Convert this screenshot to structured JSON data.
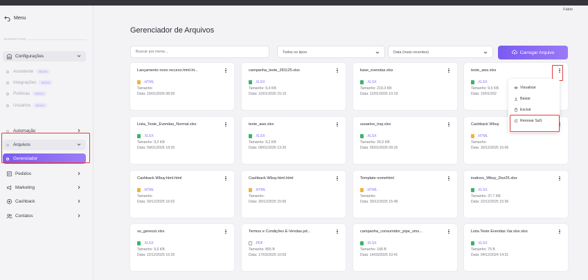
{
  "header": {
    "user_name": "Fábio"
  },
  "sidebar": {
    "menu_label": "Menu",
    "section_label": "MARKETING",
    "items": [
      {
        "label": "Configurações",
        "icon": "building-icon",
        "chevron": "down",
        "kind": "top"
      },
      {
        "label": "Assistente",
        "badge": "Breve",
        "kind": "sub"
      },
      {
        "label": "Integrações",
        "badge": "Breve",
        "kind": "sub"
      },
      {
        "label": "Políticas",
        "badge": "Breve",
        "kind": "sub"
      },
      {
        "label": "Usuários",
        "badge": "Breve",
        "kind": "sub"
      },
      {
        "label": "Automação",
        "chevron": "right",
        "kind": "plain"
      },
      {
        "label": "Arquivos",
        "chevron": "down",
        "kind": "top"
      },
      {
        "label": "Gerenciador",
        "kind": "active"
      },
      {
        "label": "Pedidos",
        "icon": "cart-icon",
        "chevron": "right",
        "kind": "plain"
      },
      {
        "label": "Marketing",
        "icon": "megaphone-icon",
        "chevron": "right",
        "kind": "plain"
      },
      {
        "label": "Cashback",
        "icon": "coin-icon",
        "chevron": "right",
        "kind": "plain"
      },
      {
        "label": "Contatos",
        "icon": "people-icon",
        "chevron": "right",
        "kind": "plain"
      }
    ]
  },
  "main": {
    "title": "Gerenciador de Arquivos",
    "search_placeholder": "Buscar por nome...",
    "type_filter": "Todos os tipos",
    "date_filter": "Data (mais recentes)",
    "upload_label": "Carregar Arquivo"
  },
  "colors": {
    "accent": "#7b5cf0",
    "html": "#f0b43a",
    "xlsx": "#3bb36a",
    "pdf": "#a2a2ad",
    "highlight": "#e03a3a"
  },
  "files": [
    {
      "name": "Lançamento novo recurso.html.ht...",
      "type": ".HTML",
      "size": "Tamanho:",
      "date": "Data: 15/01/2026 08:09"
    },
    {
      "name": "campanha_teste_281125.xlsx",
      "type": ".XLSX",
      "size": "Tamanho: 6,4 KB",
      "date": "Data: 12/01/2026 15:10"
    },
    {
      "name": "base_evendas.xlsx",
      "type": ".XLSX",
      "size": "Tamanho: 219,3 KB",
      "date": "Data: 12/01/2026 10:19"
    },
    {
      "name": "teste_aws.xlsx",
      "type": ".XLSX",
      "size": "Tamanho: 9,5 KB",
      "date": "Data: 10/01/202"
    },
    {
      "name": "Lista_Teste_Evendas_Normal.xlsx",
      "type": ".XLSX",
      "size": "Tamanho: 9,2 KB",
      "date": "Data: 09/01/2026 18:25"
    },
    {
      "name": "teste_aws.xlsx",
      "type": ".XLSX",
      "size": "Tamanho: 9,2 KB",
      "date": "Data: 09/01/2026 13:20"
    },
    {
      "name": "usuarios_tray.xlsx",
      "type": ".XLSX",
      "size": "Tamanho: 26,5 KB",
      "date": "Data: 05/01/2026 09:16"
    },
    {
      "name": "Cashback Wbuy",
      "type": ".HTML",
      "size": "Tamanho:",
      "date": "Data: 30/12/2025 16:06"
    },
    {
      "name": "Cashback Wbuy.html.html",
      "type": ".HTML",
      "size": "Tamanho:",
      "date": "Data: 30/12/2025 16:02"
    },
    {
      "name": "Cashback Wbuy.html.html",
      "type": ".HTML",
      "size": "Tamanho:",
      "date": "Data: 30/12/2025 15:56"
    },
    {
      "name": "Template nomehtml",
      "type": ".HTML",
      "size": "Tamanho:",
      "date": "Data: 30/12/2025 15:48"
    },
    {
      "name": "inativos_Wbuy_Dez25.xlsx",
      "type": ".XLSX",
      "size": "Tamanho: 37,7 KB",
      "date": "Data: 22/12/2025 15:36"
    },
    {
      "name": "so_genezzi.xlsx",
      "type": ".XLSX",
      "size": "Tamanho: 9,6 KB",
      "date": "Data: 22/12/2025 15:25"
    },
    {
      "name": "Termos e Condições E-Vendas.pd...",
      "type": ".PDF",
      "size": "Tamanho: 855 B",
      "date": "Data: 17/03/2025 10:03"
    },
    {
      "name": "campanha_consumidor_pipe_sms...",
      "type": ".XLSX",
      "size": "Tamanho: 168 B",
      "date": "Data: 14/03/2025 10:41"
    },
    {
      "name": "Lista Teste Evendas Var.xlsx.xlsx",
      "type": ".XLSX",
      "size": "Tamanho: 75 B",
      "date": "Data: 04/12/2024 14:31"
    }
  ],
  "dropdown": {
    "items": [
      {
        "label": "Visualizar",
        "icon": "eye-icon"
      },
      {
        "label": "Baixar",
        "icon": "download-icon"
      },
      {
        "label": "Excluir",
        "icon": "trash-icon"
      },
      {
        "label": "Renovar SaS",
        "icon": "refresh-icon"
      }
    ]
  }
}
